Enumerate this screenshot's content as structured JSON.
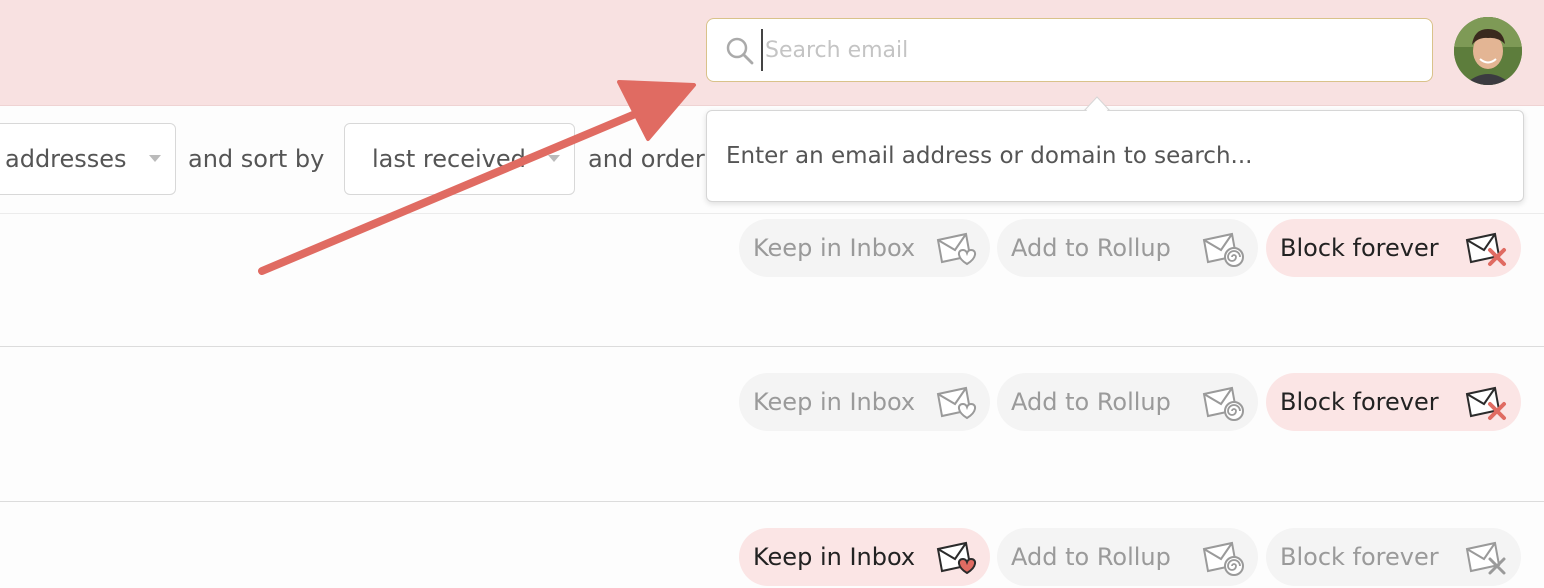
{
  "header": {
    "search": {
      "placeholder": "Search email"
    },
    "avatar": {
      "alt": "User avatar"
    }
  },
  "toolbar": {
    "addresses_select": "addresses",
    "sort_text": "and sort by",
    "sort_select": "last received",
    "order_text": "and order"
  },
  "popover": {
    "hint": "Enter an email address or domain to search..."
  },
  "rows": [
    {
      "keep_label": "Keep in Inbox",
      "rollup_label": "Add to Rollup",
      "block_label": "Block forever",
      "selected": "block"
    },
    {
      "keep_label": "Keep in Inbox",
      "rollup_label": "Add to Rollup",
      "block_label": "Block forever",
      "selected": "block"
    },
    {
      "keep_label": "Keep in Inbox",
      "rollup_label": "Add to Rollup",
      "block_label": "Block forever",
      "selected": "keep"
    }
  ],
  "colors": {
    "header_bg": "#f8e1e1",
    "active_pill_bg": "#fbe5e5",
    "accent_red": "#e06b62",
    "annotation_arrow": "#e06b62"
  },
  "icons": {
    "search": "search-icon",
    "keep": "envelope-heart-icon",
    "rollup": "envelope-spiral-icon",
    "block": "envelope-x-icon"
  }
}
